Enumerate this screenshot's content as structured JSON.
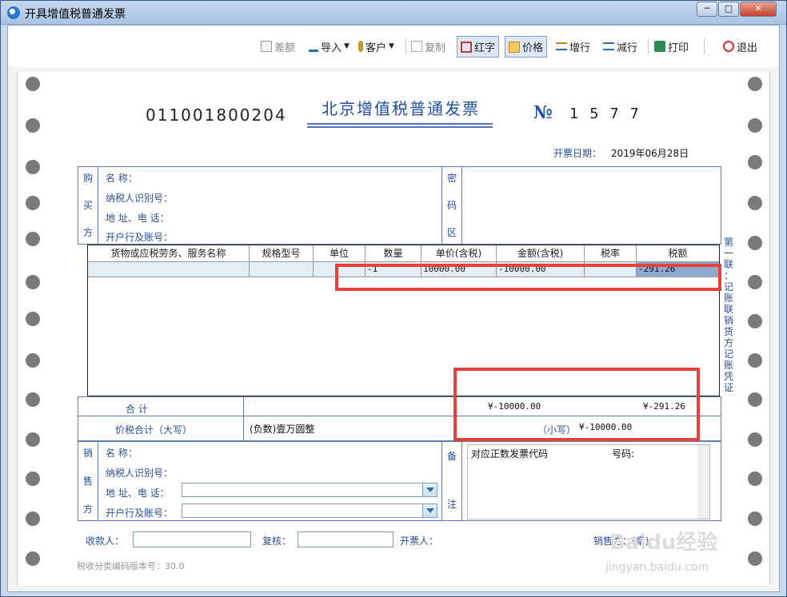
{
  "window": {
    "title": "开具增值税普通发票"
  },
  "toolbar": {
    "diff": "差额",
    "import": "导入",
    "customer": "客户",
    "copy": "复制",
    "red": "红字",
    "price": "价格",
    "add_row": "增行",
    "del_row": "减行",
    "print": "打印",
    "exit": "退出"
  },
  "invoice": {
    "title": "北京增值税普通发票",
    "code": "011001800204",
    "no_symbol": "№",
    "number": "1      5 7 7",
    "date_label": "开票日期：",
    "date": "2019年06月28日",
    "buyer": {
      "section": [
        "购",
        "买",
        "方"
      ],
      "name_label": "名          称：",
      "taxid_label": "纳税人识别号：",
      "address_label": "地  址、电  话：",
      "bank_label": "开户行及账号："
    },
    "cipher": [
      "密",
      "码",
      "区"
    ],
    "columns": [
      "货物或应税劳务、服务名称",
      "规格型号",
      "单位",
      "数量",
      "单价(含税)",
      "金额(含税)",
      "税率",
      "税额"
    ],
    "row": {
      "qty": "-1",
      "unit_price": "10000.00",
      "amount": "-10000.00",
      "tax": "-291.26"
    },
    "total_label": "合          计",
    "total_amount": "¥-10000.00",
    "total_tax": "¥-291.26",
    "grand_label": "价税合计（大写）",
    "grand_upper": "(负数)壹万圆整",
    "small_label": "（小写）",
    "grand_lower": "¥-10000.00",
    "seller": {
      "section": [
        "销",
        "售",
        "方"
      ],
      "name_label": "名          称：",
      "taxid_label": "纳税人识别号：",
      "address_label": "地  址、电  话：",
      "bank_label": "开户行及账号："
    },
    "remark_section": [
      "备",
      "注"
    ],
    "remark_text": "对应正数发票代码",
    "remark_no": "号码:",
    "side_text": [
      "第",
      "一",
      "联",
      "：",
      "记",
      "账",
      "联",
      " ",
      "销",
      "货",
      "方",
      "记",
      "账",
      "凭",
      "证"
    ],
    "payee_label": "收款人：",
    "reviewer_label": "复核：",
    "drawer_label": "开票人：",
    "seller_seal": "销售方：(章)",
    "version": "税收分类编码版本号：30.0"
  },
  "watermark": {
    "logo": "Baidu经验",
    "url": "jingyan.baidu.com"
  },
  "colors": {
    "accent": "#2a4f9a",
    "highlight": "#e8403a"
  }
}
